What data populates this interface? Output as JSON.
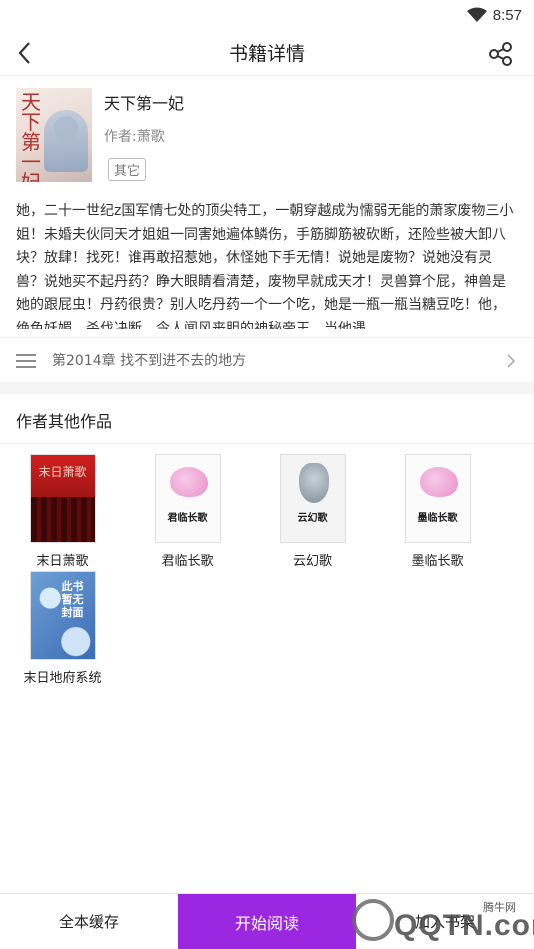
{
  "status_bar": {
    "time": "8:57"
  },
  "header": {
    "title": "书籍详情"
  },
  "book": {
    "title": "天下第一妃",
    "cover_title": "天下第一妃",
    "author": "作者:萧歌",
    "tag": "其它",
    "description": "她，二十一世纪z国军情七处的顶尖特工，一朝穿越成为懦弱无能的萧家废物三小姐！未婚夫伙同天才姐姐一同害她遍体鳞伤，手筋脚筋被砍断，还险些被大卸八块？放肆！找死！谁再敢招惹她，休怪她下手无情！说她是废物？说她没有灵兽？说她买不起丹药？睁大眼睛看清楚，废物早就成天才！灵兽算个屁，神兽是她的跟屁虫！丹药很贵？别人吃丹药一个一个吃，她是一瓶一瓶当糖豆吃！他，绝色妖媚，杀伐决断，令人闻风丧胆的神秘帝王。当他遇"
  },
  "latest_chapter": {
    "label": "第2014章 找不到进不去的地方"
  },
  "other_works": {
    "section_title": "作者其他作品",
    "items": [
      {
        "name": "末日萧歌",
        "cover_text": "末日萧歌",
        "style": "red"
      },
      {
        "name": "君临长歌",
        "cover_text": "君临长歌",
        "style": "pink"
      },
      {
        "name": "云幻歌",
        "cover_text": "云幻歌",
        "style": "gray"
      },
      {
        "name": "墨临长歌",
        "cover_text": "墨临长歌",
        "style": "pink"
      },
      {
        "name": "末日地府系统",
        "cover_text": "此书暂无封面",
        "style": "blue"
      }
    ]
  },
  "bottom_bar": {
    "cache_label": "全本缓存",
    "read_label": "开始阅读",
    "shelf_label": "加入书架"
  },
  "watermark": {
    "text": "QQTN.com",
    "small_text": "腾牛网"
  },
  "colors": {
    "accent": "#9c27e0",
    "divider": "#eeeeee",
    "section_bg": "#f5f5f5"
  }
}
